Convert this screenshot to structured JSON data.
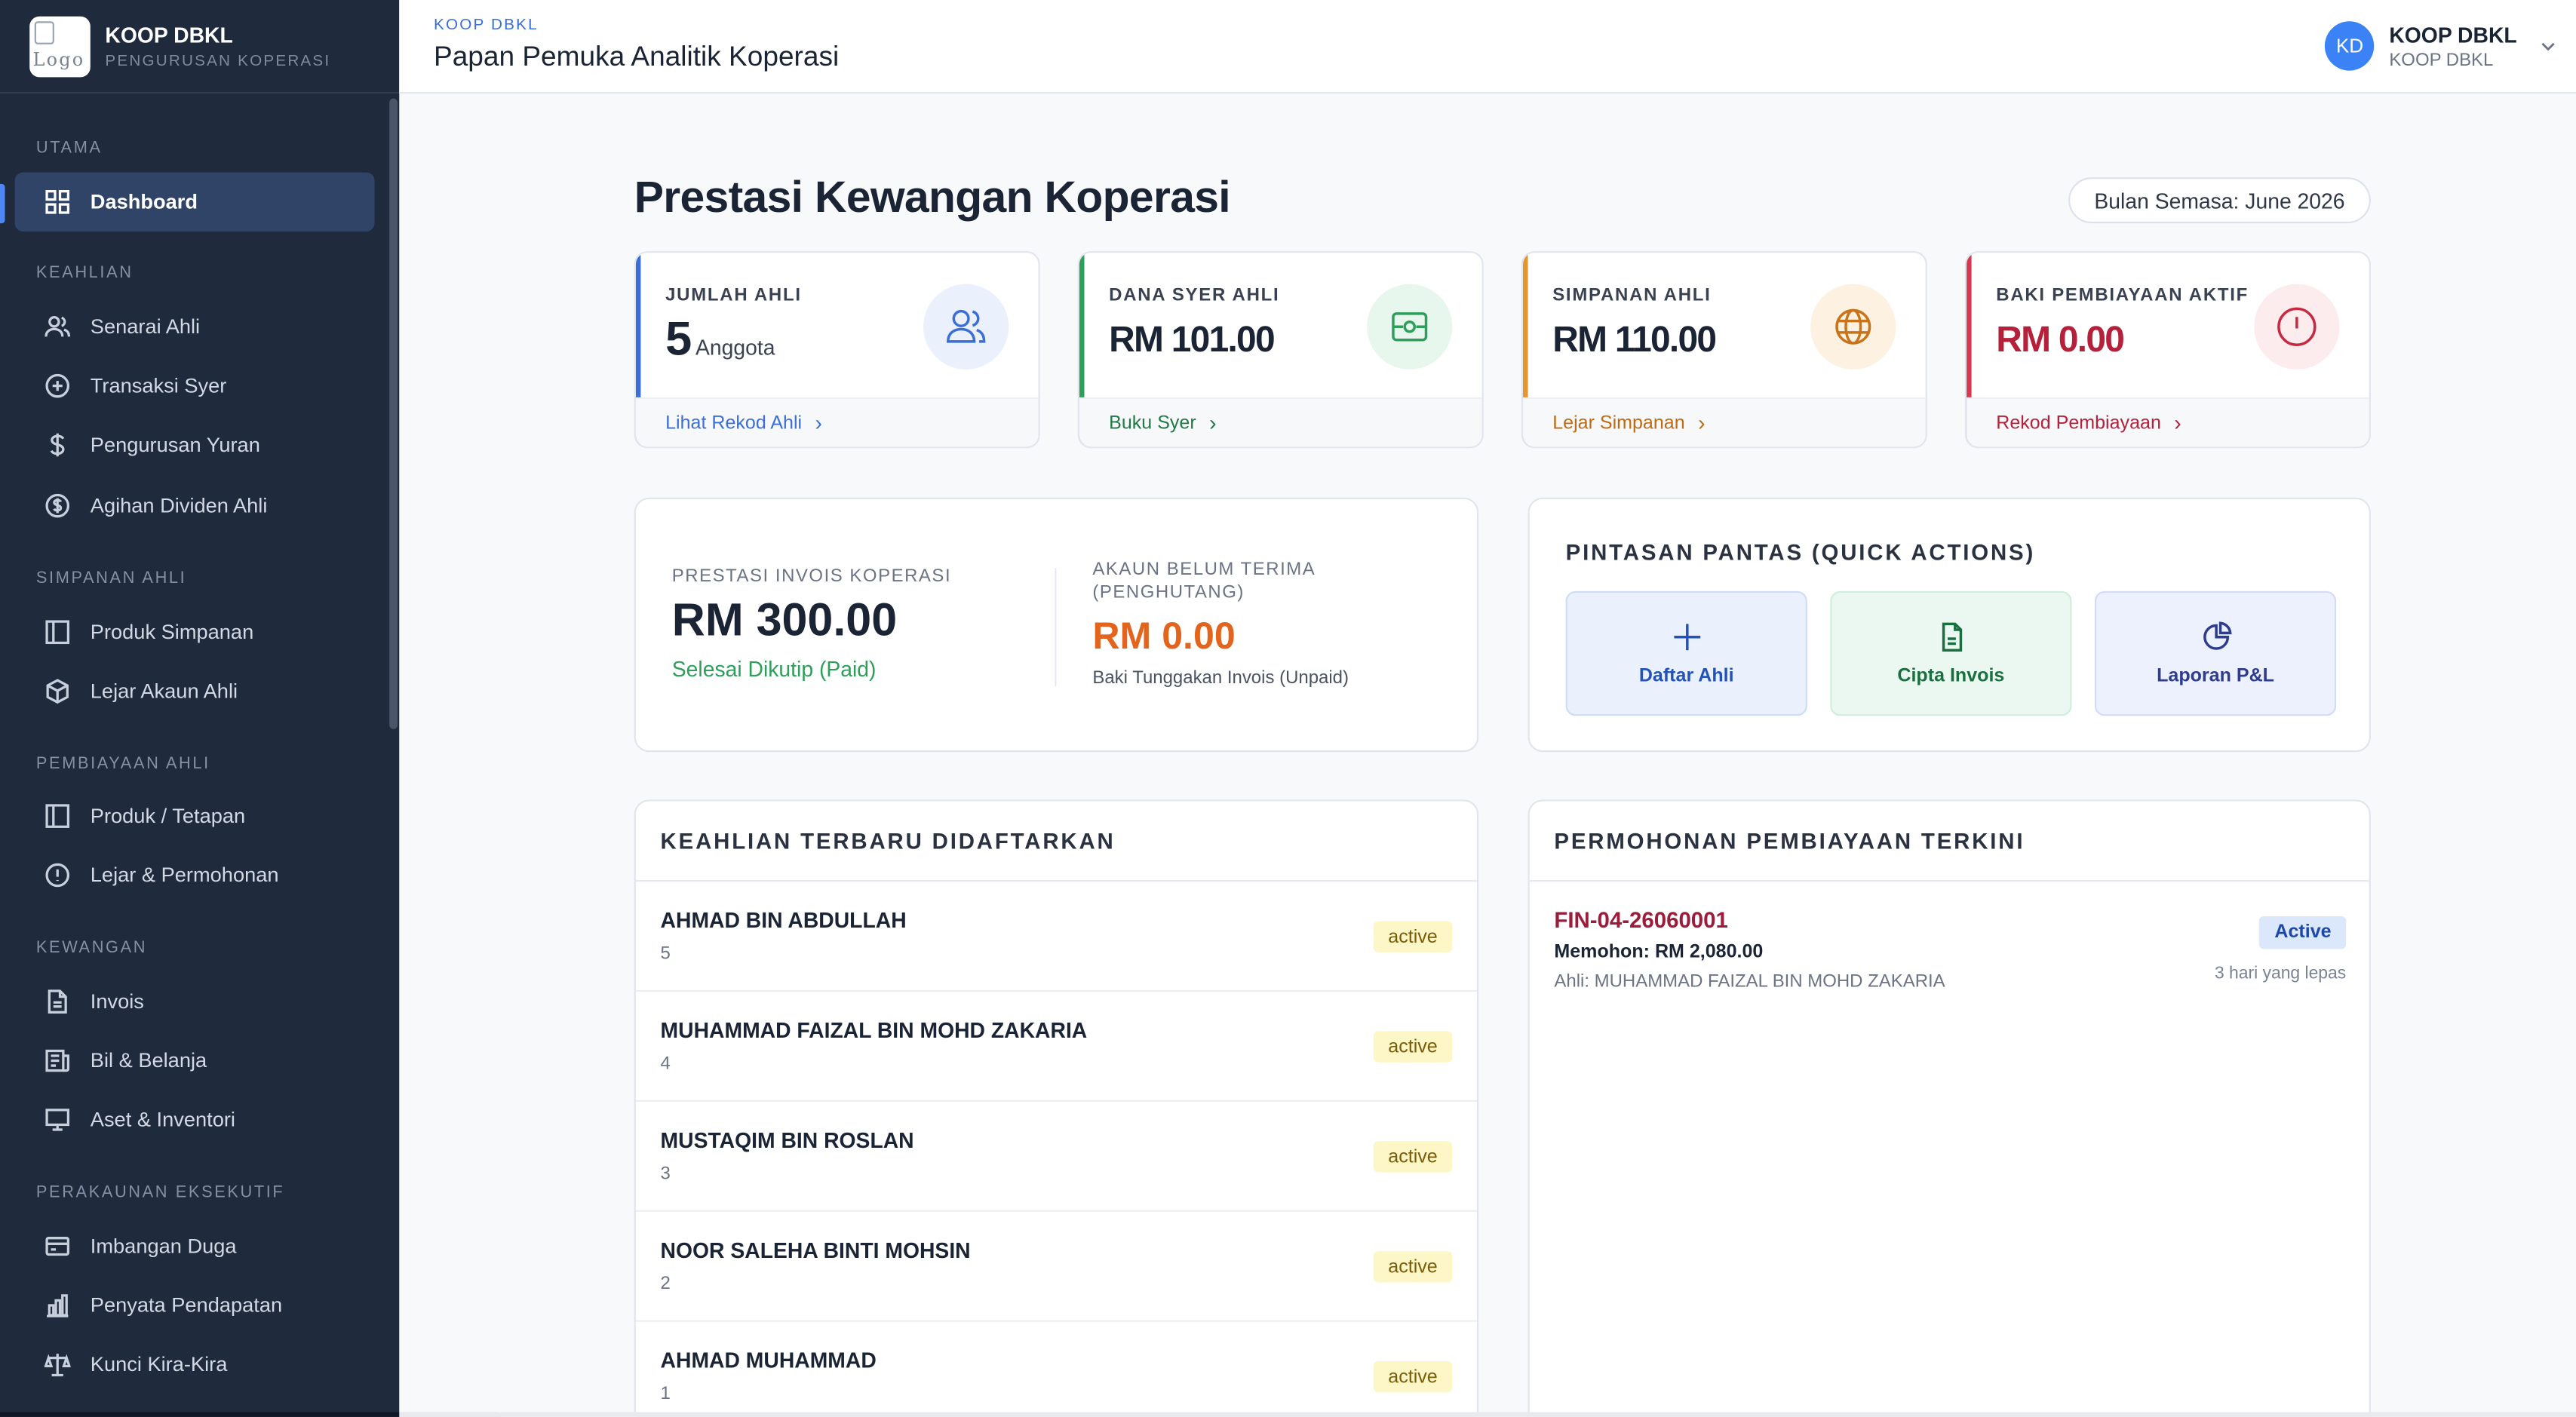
{
  "brand": {
    "name": "KOOP DBKL",
    "subtitle": "PENGURUSAN KOPERASI",
    "logo_alt": "Logo"
  },
  "header": {
    "crumb": "KOOP DBKL",
    "title": "Papan Pemuka Analitik Koperasi"
  },
  "user": {
    "initials": "KD",
    "name": "KOOP DBKL",
    "org": "KOOP DBKL"
  },
  "sidebar": {
    "sections": [
      {
        "title": "UTAMA",
        "items": [
          {
            "label": "Dashboard",
            "icon": "grid-icon",
            "active": true
          }
        ]
      },
      {
        "title": "KEAHLIAN",
        "items": [
          {
            "label": "Senarai Ahli",
            "icon": "users-icon"
          },
          {
            "label": "Transaksi Syer",
            "icon": "plus-circle-icon"
          },
          {
            "label": "Pengurusan Yuran",
            "icon": "dollar-icon"
          },
          {
            "label": "Agihan Dividen Ahli",
            "icon": "dollar-circle-icon"
          }
        ]
      },
      {
        "title": "SIMPANAN AHLI",
        "items": [
          {
            "label": "Produk Simpanan",
            "icon": "panel-icon"
          },
          {
            "label": "Lejar Akaun Ahli",
            "icon": "cube-icon"
          }
        ]
      },
      {
        "title": "PEMBIAYAAN AHLI",
        "items": [
          {
            "label": "Produk / Tetapan",
            "icon": "panel-icon"
          },
          {
            "label": "Lejar & Permohonan",
            "icon": "alert-circle-icon"
          }
        ]
      },
      {
        "title": "KEWANGAN",
        "items": [
          {
            "label": "Invois",
            "icon": "document-icon"
          },
          {
            "label": "Bil & Belanja",
            "icon": "receipt-icon"
          },
          {
            "label": "Aset & Inventori",
            "icon": "monitor-icon"
          }
        ]
      },
      {
        "title": "PERAKAUNAN EKSEKUTIF",
        "items": [
          {
            "label": "Imbangan Duga",
            "icon": "card-icon"
          },
          {
            "label": "Penyata Pendapatan",
            "icon": "bar-chart-icon"
          },
          {
            "label": "Kunci Kira-Kira",
            "icon": "scale-icon"
          }
        ]
      }
    ]
  },
  "main": {
    "title": "Prestasi Kewangan Koperasi",
    "month": "Bulan Semasa: June 2026",
    "stats": [
      {
        "label": "JUMLAH AHLI",
        "value": "5",
        "unit": "Anggota",
        "link": "Lihat Rekod Ahli",
        "color": "#3b6fd6",
        "icon": "users-icon"
      },
      {
        "label": "DANA SYER AHLI",
        "value": "RM 101.00",
        "link": "Buku Syer",
        "color": "#1f8a4c",
        "icon": "wallet-icon"
      },
      {
        "label": "SIMPANAN AHLI",
        "value": "RM 110.00",
        "link": "Lejar Simpanan",
        "color": "#c8741a",
        "icon": "globe-icon"
      },
      {
        "label": "BAKI PEMBIAYAAN AKTIF",
        "value": "RM 0.00",
        "link": "Rekod Pembiayaan",
        "color": "#c62a43",
        "icon": "alert-icon"
      }
    ],
    "invoice": {
      "label": "PRESTASI INVOIS KOPERASI",
      "value": "RM 300.00",
      "status": "Selesai Dikutip (Paid)",
      "receivable_label_1": "AKAUN BELUM TERIMA",
      "receivable_label_2": "(PENGHUTANG)",
      "receivable_value": "RM 0.00",
      "receivable_note": "Baki Tunggakan Invois (Unpaid)"
    },
    "quick_actions": {
      "title": "PINTASAN PANTAS (QUICK ACTIONS)",
      "items": [
        {
          "label": "Daftar Ahli",
          "icon": "plus-icon"
        },
        {
          "label": "Cipta Invois",
          "icon": "document-icon"
        },
        {
          "label": "Laporan P&L",
          "icon": "pie-chart-icon"
        }
      ]
    },
    "members": {
      "title": "KEAHLIAN TERBARU DIDAFTARKAN",
      "rows": [
        {
          "name": "AHMAD BIN ABDULLAH",
          "no": "5",
          "status": "active"
        },
        {
          "name": "MUHAMMAD FAIZAL BIN MOHD ZAKARIA",
          "no": "4",
          "status": "active"
        },
        {
          "name": "MUSTAQIM BIN ROSLAN",
          "no": "3",
          "status": "active"
        },
        {
          "name": "NOOR SALEHA BINTI MOHSIN",
          "no": "2",
          "status": "active"
        },
        {
          "name": "AHMAD MUHAMMAD",
          "no": "1",
          "status": "active"
        }
      ]
    },
    "financing": {
      "title": "PERMOHONAN PEMBIAYAAN TERKINI",
      "items": [
        {
          "id": "FIN-04-26060001",
          "amount": "Memohon: RM 2,080.00",
          "member": "Ahli: MUHAMMAD FAIZAL BIN MOHD ZAKARIA",
          "status": "Active",
          "time": "3 hari yang lepas"
        }
      ]
    }
  }
}
